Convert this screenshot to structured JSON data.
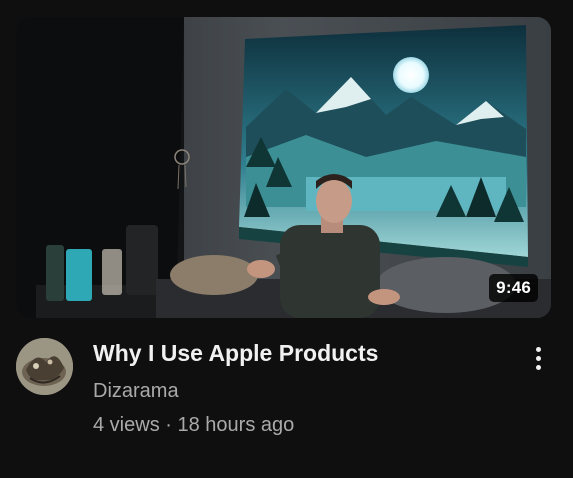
{
  "video": {
    "title": "Why I Use Apple Products",
    "duration": "9:46",
    "channel": "Dizarama",
    "views": "4 views",
    "separator": "·",
    "age": "18 hours ago"
  },
  "icons": {
    "menu": "more-vert-icon",
    "avatar": "channel-avatar"
  },
  "colors": {
    "background": "#0f0f0f",
    "title": "#f1f1f1",
    "secondary_text": "#aaaaaa",
    "duration_badge": "#000000"
  }
}
